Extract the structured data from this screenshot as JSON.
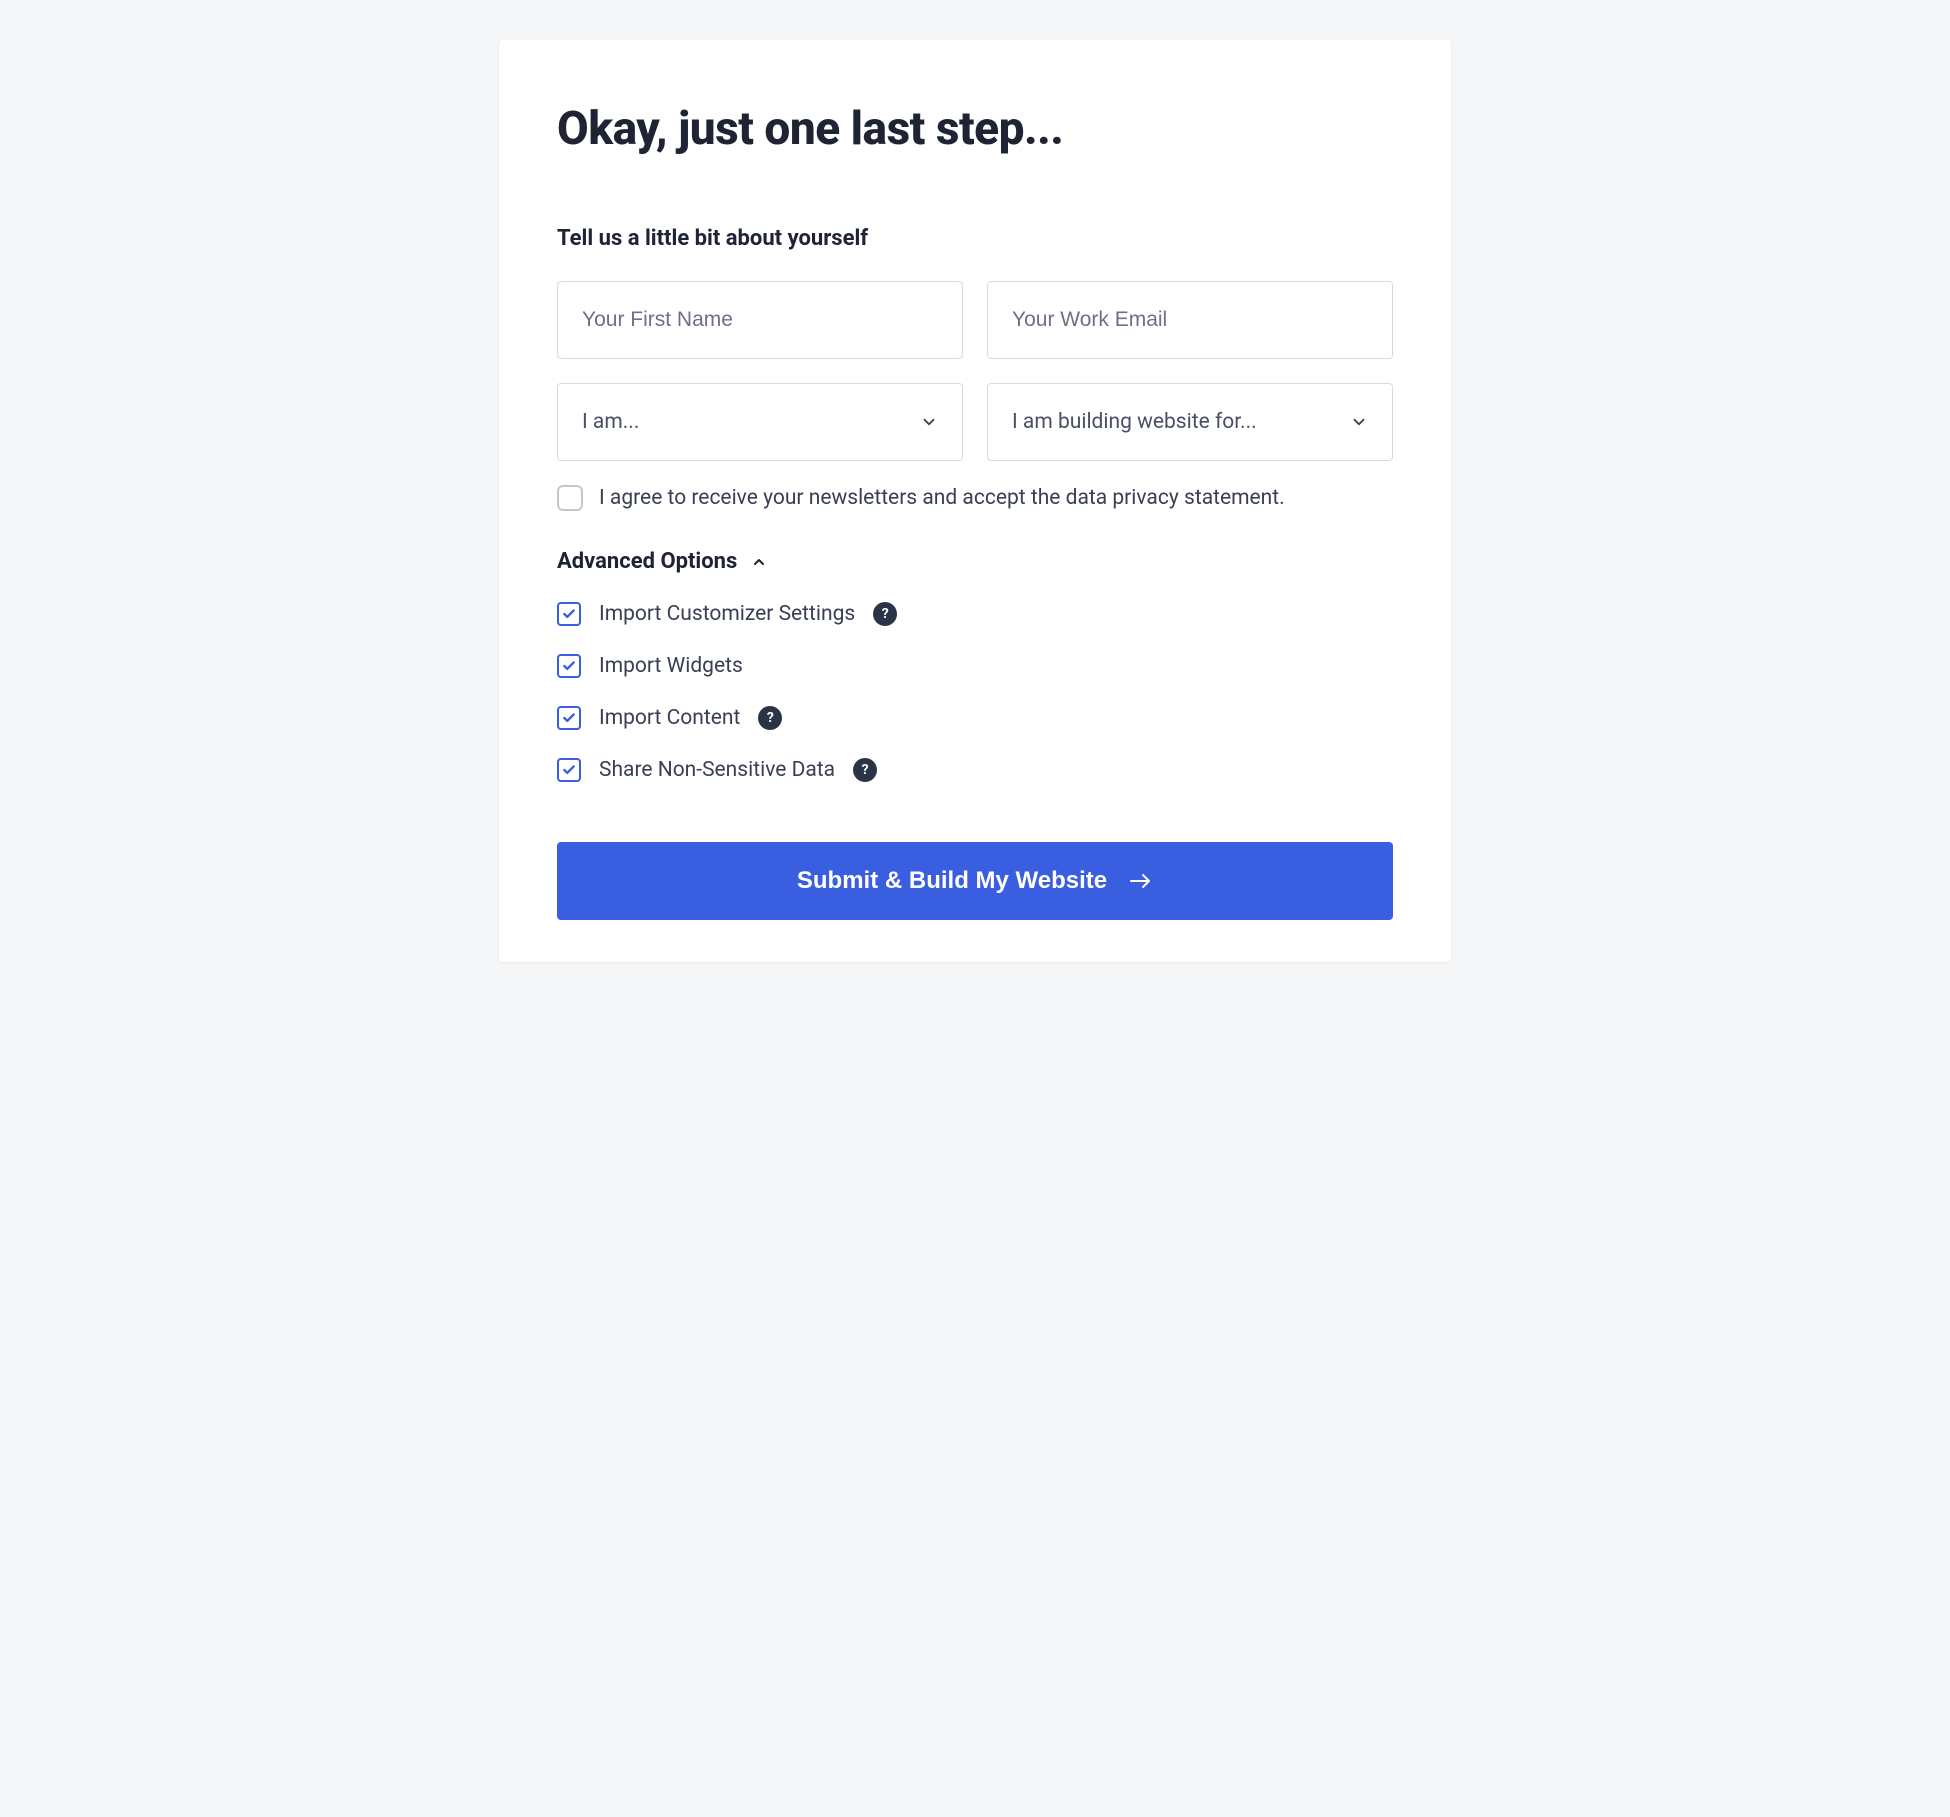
{
  "title": "Okay, just one last step...",
  "subtitle": "Tell us a little bit about yourself",
  "fields": {
    "first_name_placeholder": "Your First Name",
    "email_placeholder": "Your Work Email",
    "role_select": "I am...",
    "building_for_select": "I am building website for..."
  },
  "consent_text": "I agree to receive your newsletters and accept the data privacy statement.",
  "advanced_header": "Advanced Options",
  "advanced_options": {
    "import_customizer": "Import Customizer Settings",
    "import_widgets": "Import Widgets",
    "import_content": "Import Content",
    "share_data": "Share Non-Sensitive Data"
  },
  "submit_label": "Submit & Build My Website",
  "help_glyph": "?"
}
